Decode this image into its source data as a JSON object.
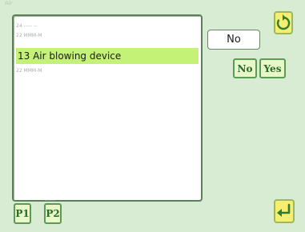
{
  "window": {
    "title": "Air"
  },
  "list": {
    "rows": [
      {
        "label": "24  ----- --"
      },
      {
        "label": "22 MMM-M"
      },
      {
        "label": "13 Air blowing device"
      },
      {
        "label": "22 MMM-M"
      }
    ]
  },
  "dialog": {
    "current_value": "No",
    "no_label": "No",
    "yes_label": "Yes"
  },
  "pager": {
    "p1_label": "P1",
    "p2_label": "P2",
    "tab_hint": "------"
  },
  "icons": {
    "top": "refresh-icon",
    "bottom": "return-icon"
  },
  "colors": {
    "background": "#d8ebd3",
    "selected_row": "#c4f276",
    "icon_button": "#f6ee70",
    "accent": "#276b29"
  }
}
